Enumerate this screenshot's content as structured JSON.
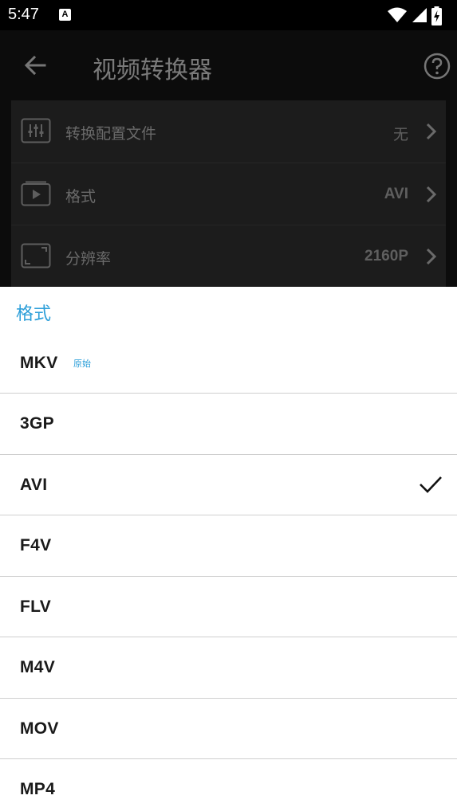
{
  "status_bar": {
    "time": "5:47",
    "notification_icon_letter": "A",
    "icons": [
      "a-notification-icon",
      "wifi-icon",
      "cellular-signal-icon",
      "battery-charging-icon"
    ]
  },
  "app_bar": {
    "title": "视频转换器",
    "back_icon": "arrow-left-icon",
    "help_icon": "help-circle-icon"
  },
  "settings": [
    {
      "icon": "sliders-icon",
      "label": "转换配置文件",
      "value": "无"
    },
    {
      "icon": "video-play-icon",
      "label": "格式",
      "value": "AVI"
    },
    {
      "icon": "resolution-frame-icon",
      "label": "分辨率",
      "value": "2160P"
    }
  ],
  "sheet": {
    "title": "格式",
    "selected": "AVI",
    "formats": [
      {
        "name": "MKV",
        "tag": "原始"
      },
      {
        "name": "3GP",
        "tag": ""
      },
      {
        "name": "AVI",
        "tag": ""
      },
      {
        "name": "F4V",
        "tag": ""
      },
      {
        "name": "FLV",
        "tag": ""
      },
      {
        "name": "M4V",
        "tag": ""
      },
      {
        "name": "MOV",
        "tag": ""
      },
      {
        "name": "MP4",
        "tag": ""
      }
    ]
  },
  "colors": {
    "accent": "#2d9fd9",
    "status_bar": "#000000",
    "dim_background": "#0c0c0c",
    "card": "#1c1c1c"
  }
}
